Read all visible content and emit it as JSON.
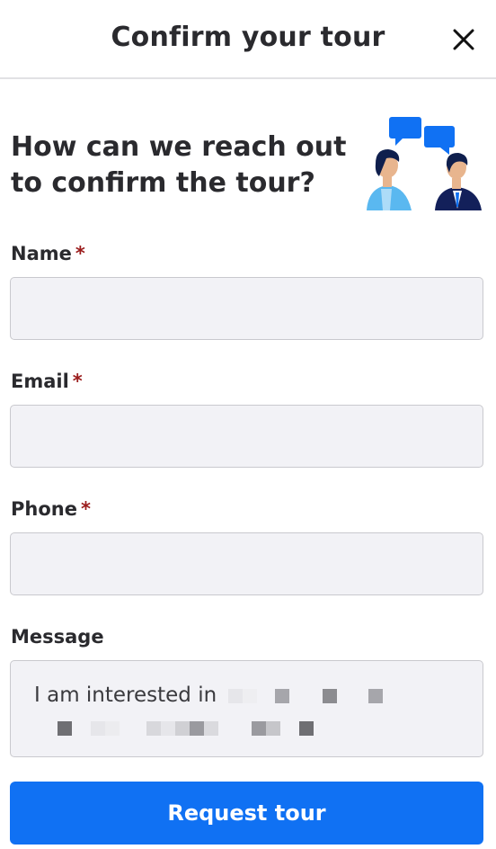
{
  "header": {
    "title": "Confirm your tour",
    "close_icon": "close-icon"
  },
  "intro": {
    "headline": "How can we reach out to confirm the tour?",
    "illustration": "two-people-chat-illustration"
  },
  "form": {
    "fields": [
      {
        "label": "Name",
        "required_mark": "*",
        "value": ""
      },
      {
        "label": "Email",
        "required_mark": "*",
        "value": ""
      },
      {
        "label": "Phone",
        "required_mark": "*",
        "value": ""
      }
    ],
    "message": {
      "label": "Message",
      "text": "I am interested in"
    },
    "submit_label": "Request tour"
  },
  "colors": {
    "accent": "#1071f3",
    "required": "#9b1c1c",
    "input_bg": "#f2f2f6"
  }
}
